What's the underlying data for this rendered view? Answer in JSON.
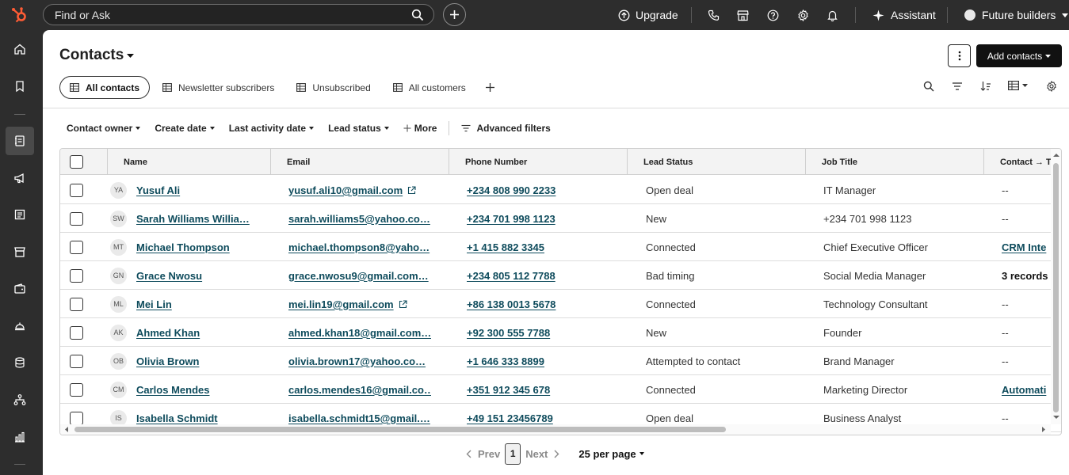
{
  "topbar": {
    "search_placeholder": "Find or Ask",
    "upgrade_label": "Upgrade",
    "assistant_label": "Assistant",
    "account_label": "Future builders"
  },
  "page": {
    "title": "Contacts",
    "add_button_label": "Add contacts"
  },
  "tabs": [
    {
      "label": "All contacts",
      "active": true
    },
    {
      "label": "Newsletter subscribers",
      "active": false
    },
    {
      "label": "Unsubscribed",
      "active": false
    },
    {
      "label": "All customers",
      "active": false
    }
  ],
  "filters": {
    "contact_owner": "Contact owner",
    "create_date": "Create date",
    "last_activity_date": "Last activity date",
    "lead_status": "Lead status",
    "more": "More",
    "advanced": "Advanced filters"
  },
  "table": {
    "columns": [
      "Name",
      "Email",
      "Phone Number",
      "Lead Status",
      "Job Title",
      "Contact → T"
    ],
    "rows": [
      {
        "initials": "YA",
        "name": "Yusuf Ali",
        "email": "yusuf.ali10@gmail.com",
        "ext": true,
        "phone": "+234 808 990 2233",
        "status": "Open deal",
        "job": "IT Manager",
        "extra": "--",
        "extra_style": "plain"
      },
      {
        "initials": "SW",
        "name": "Sarah Williams Willia…",
        "email": "sarah.williams5@yahoo.co…",
        "ext": false,
        "phone": "+234 701 998 1123",
        "status": "New",
        "job": "+234 701 998 1123",
        "extra": "--",
        "extra_style": "plain"
      },
      {
        "initials": "MT",
        "name": "Michael Thompson",
        "email": "michael.thompson8@yaho…",
        "ext": false,
        "phone": "+1 415 882 3345",
        "status": "Connected",
        "job": "Chief Executive Officer",
        "extra": "CRM Inte",
        "extra_style": "link"
      },
      {
        "initials": "GN",
        "name": "Grace Nwosu",
        "email": "grace.nwosu9@gmail.com…",
        "ext": false,
        "phone": "+234 805 112 7788",
        "status": "Bad timing",
        "job": "Social Media Manager",
        "extra": "3 records",
        "extra_style": "bold"
      },
      {
        "initials": "ML",
        "name": "Mei Lin",
        "email": "mei.lin19@gmail.com",
        "ext": true,
        "phone": "+86 138 0013 5678",
        "status": "Connected",
        "job": "Technology Consultant",
        "extra": "--",
        "extra_style": "plain"
      },
      {
        "initials": "AK",
        "name": "Ahmed Khan",
        "email": "ahmed.khan18@gmail.com…",
        "ext": false,
        "phone": "+92 300 555 7788",
        "status": "New",
        "job": "Founder",
        "extra": "--",
        "extra_style": "plain"
      },
      {
        "initials": "OB",
        "name": "Olivia Brown",
        "email": "olivia.brown17@yahoo.co…",
        "ext": false,
        "phone": "+1 646 333 8899",
        "status": "Attempted to contact",
        "job": "Brand Manager",
        "extra": "--",
        "extra_style": "plain"
      },
      {
        "initials": "CM",
        "name": "Carlos Mendes",
        "email": "carlos.mendes16@gmail.co…",
        "ext": false,
        "phone": "+351 912 345 678",
        "status": "Connected",
        "job": "Marketing Director",
        "extra": "Automati",
        "extra_style": "link"
      },
      {
        "initials": "IS",
        "name": "Isabella Schmidt",
        "email": "isabella.schmidt15@gmail.…",
        "ext": false,
        "phone": "+49 151 23456789",
        "status": "Open deal",
        "job": "Business Analyst",
        "extra": "--",
        "extra_style": "plain"
      }
    ]
  },
  "pagination": {
    "prev": "Prev",
    "page": "1",
    "next": "Next",
    "per_page": "25 per page"
  },
  "colors": {
    "link": "#0e4b5c",
    "topbar": "#2d2d2d",
    "accent": "#ff5c35"
  }
}
